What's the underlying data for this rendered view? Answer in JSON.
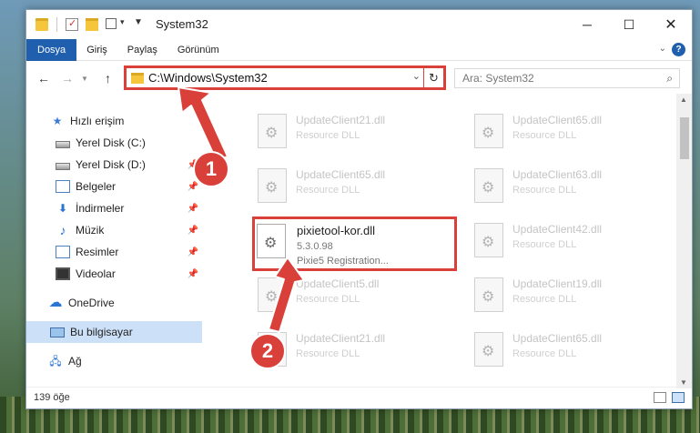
{
  "window": {
    "title": "System32",
    "controls": {
      "minimize": "─",
      "maximize": "☐",
      "close": "✕"
    }
  },
  "ribbon": {
    "tabs": [
      "Dosya",
      "Giriş",
      "Paylaş",
      "Görünüm"
    ],
    "help": "?"
  },
  "navigation": {
    "path": "C:\\Windows\\System32",
    "search_placeholder": "Ara: System32"
  },
  "sidebar": {
    "items": [
      {
        "label": "Hızlı erişim",
        "icon": "star-icon",
        "pinned": false
      },
      {
        "label": "Yerel Disk (C:)",
        "icon": "drive-icon",
        "pinned": false
      },
      {
        "label": "Yerel Disk (D:)",
        "icon": "drive-icon",
        "pinned": true
      },
      {
        "label": "Belgeler",
        "icon": "documents-icon",
        "pinned": true
      },
      {
        "label": "İndirmeler",
        "icon": "download-icon",
        "pinned": true
      },
      {
        "label": "Müzik",
        "icon": "music-icon",
        "pinned": true
      },
      {
        "label": "Resimler",
        "icon": "pictures-icon",
        "pinned": true
      },
      {
        "label": "Videolar",
        "icon": "video-icon",
        "pinned": true
      },
      {
        "label": "OneDrive",
        "icon": "cloud-icon",
        "pinned": false
      },
      {
        "label": "Bu bilgisayar",
        "icon": "computer-icon",
        "pinned": false,
        "selected": true
      },
      {
        "label": "Ağ",
        "icon": "network-icon",
        "pinned": false
      }
    ]
  },
  "files": [
    {
      "name": "UpdateClient21.dll",
      "type": "Resource DLL"
    },
    {
      "name": "UpdateClient65.dll",
      "type": "Resource DLL"
    },
    {
      "name": "UpdateClient65.dll",
      "type": "Resource DLL"
    },
    {
      "name": "UpdateClient63.dll",
      "type": "Resource DLL"
    },
    {
      "name": "pixietool-kor.dll",
      "version": "5.3.0.98",
      "description": "Pixie5 Registration...",
      "highlighted": true
    },
    {
      "name": "UpdateClient42.dll",
      "type": "Resource DLL"
    },
    {
      "name": "UpdateClient5.dll",
      "type": "Resource DLL"
    },
    {
      "name": "UpdateClient19.dll",
      "type": "Resource DLL"
    },
    {
      "name": "UpdateClient21.dll",
      "type": "Resource DLL"
    },
    {
      "name": "UpdateClient65.dll",
      "type": "Resource DLL"
    }
  ],
  "status": {
    "count_text": "139 öğe"
  },
  "annotations": {
    "step1": "1",
    "step2": "2",
    "color": "#d9403a"
  }
}
